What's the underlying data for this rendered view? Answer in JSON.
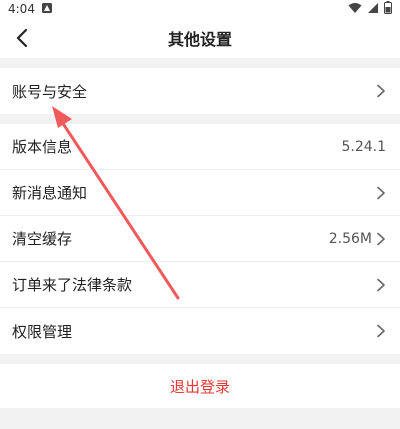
{
  "status": {
    "time": "4:04"
  },
  "header": {
    "title": "其他设置"
  },
  "groups": [
    {
      "items": [
        {
          "label": "账号与安全",
          "value": ""
        }
      ]
    },
    {
      "items": [
        {
          "label": "版本信息",
          "value": "5.24.1"
        },
        {
          "label": "新消息通知",
          "value": ""
        },
        {
          "label": "清空缓存",
          "value": "2.56M"
        },
        {
          "label": "订单来了法律条款",
          "value": ""
        },
        {
          "label": "权限管理",
          "value": ""
        }
      ]
    }
  ],
  "logout": {
    "label": "退出登录"
  },
  "colors": {
    "accent": "#e53935",
    "annotation_arrow": "#f05a5a",
    "background": "#f2f2f2"
  },
  "icons": {
    "back": "chevron-left-icon",
    "row_arrow": "chevron-right-icon",
    "wifi": "wifi-icon",
    "signal": "signal-icon",
    "battery": "battery-icon"
  }
}
